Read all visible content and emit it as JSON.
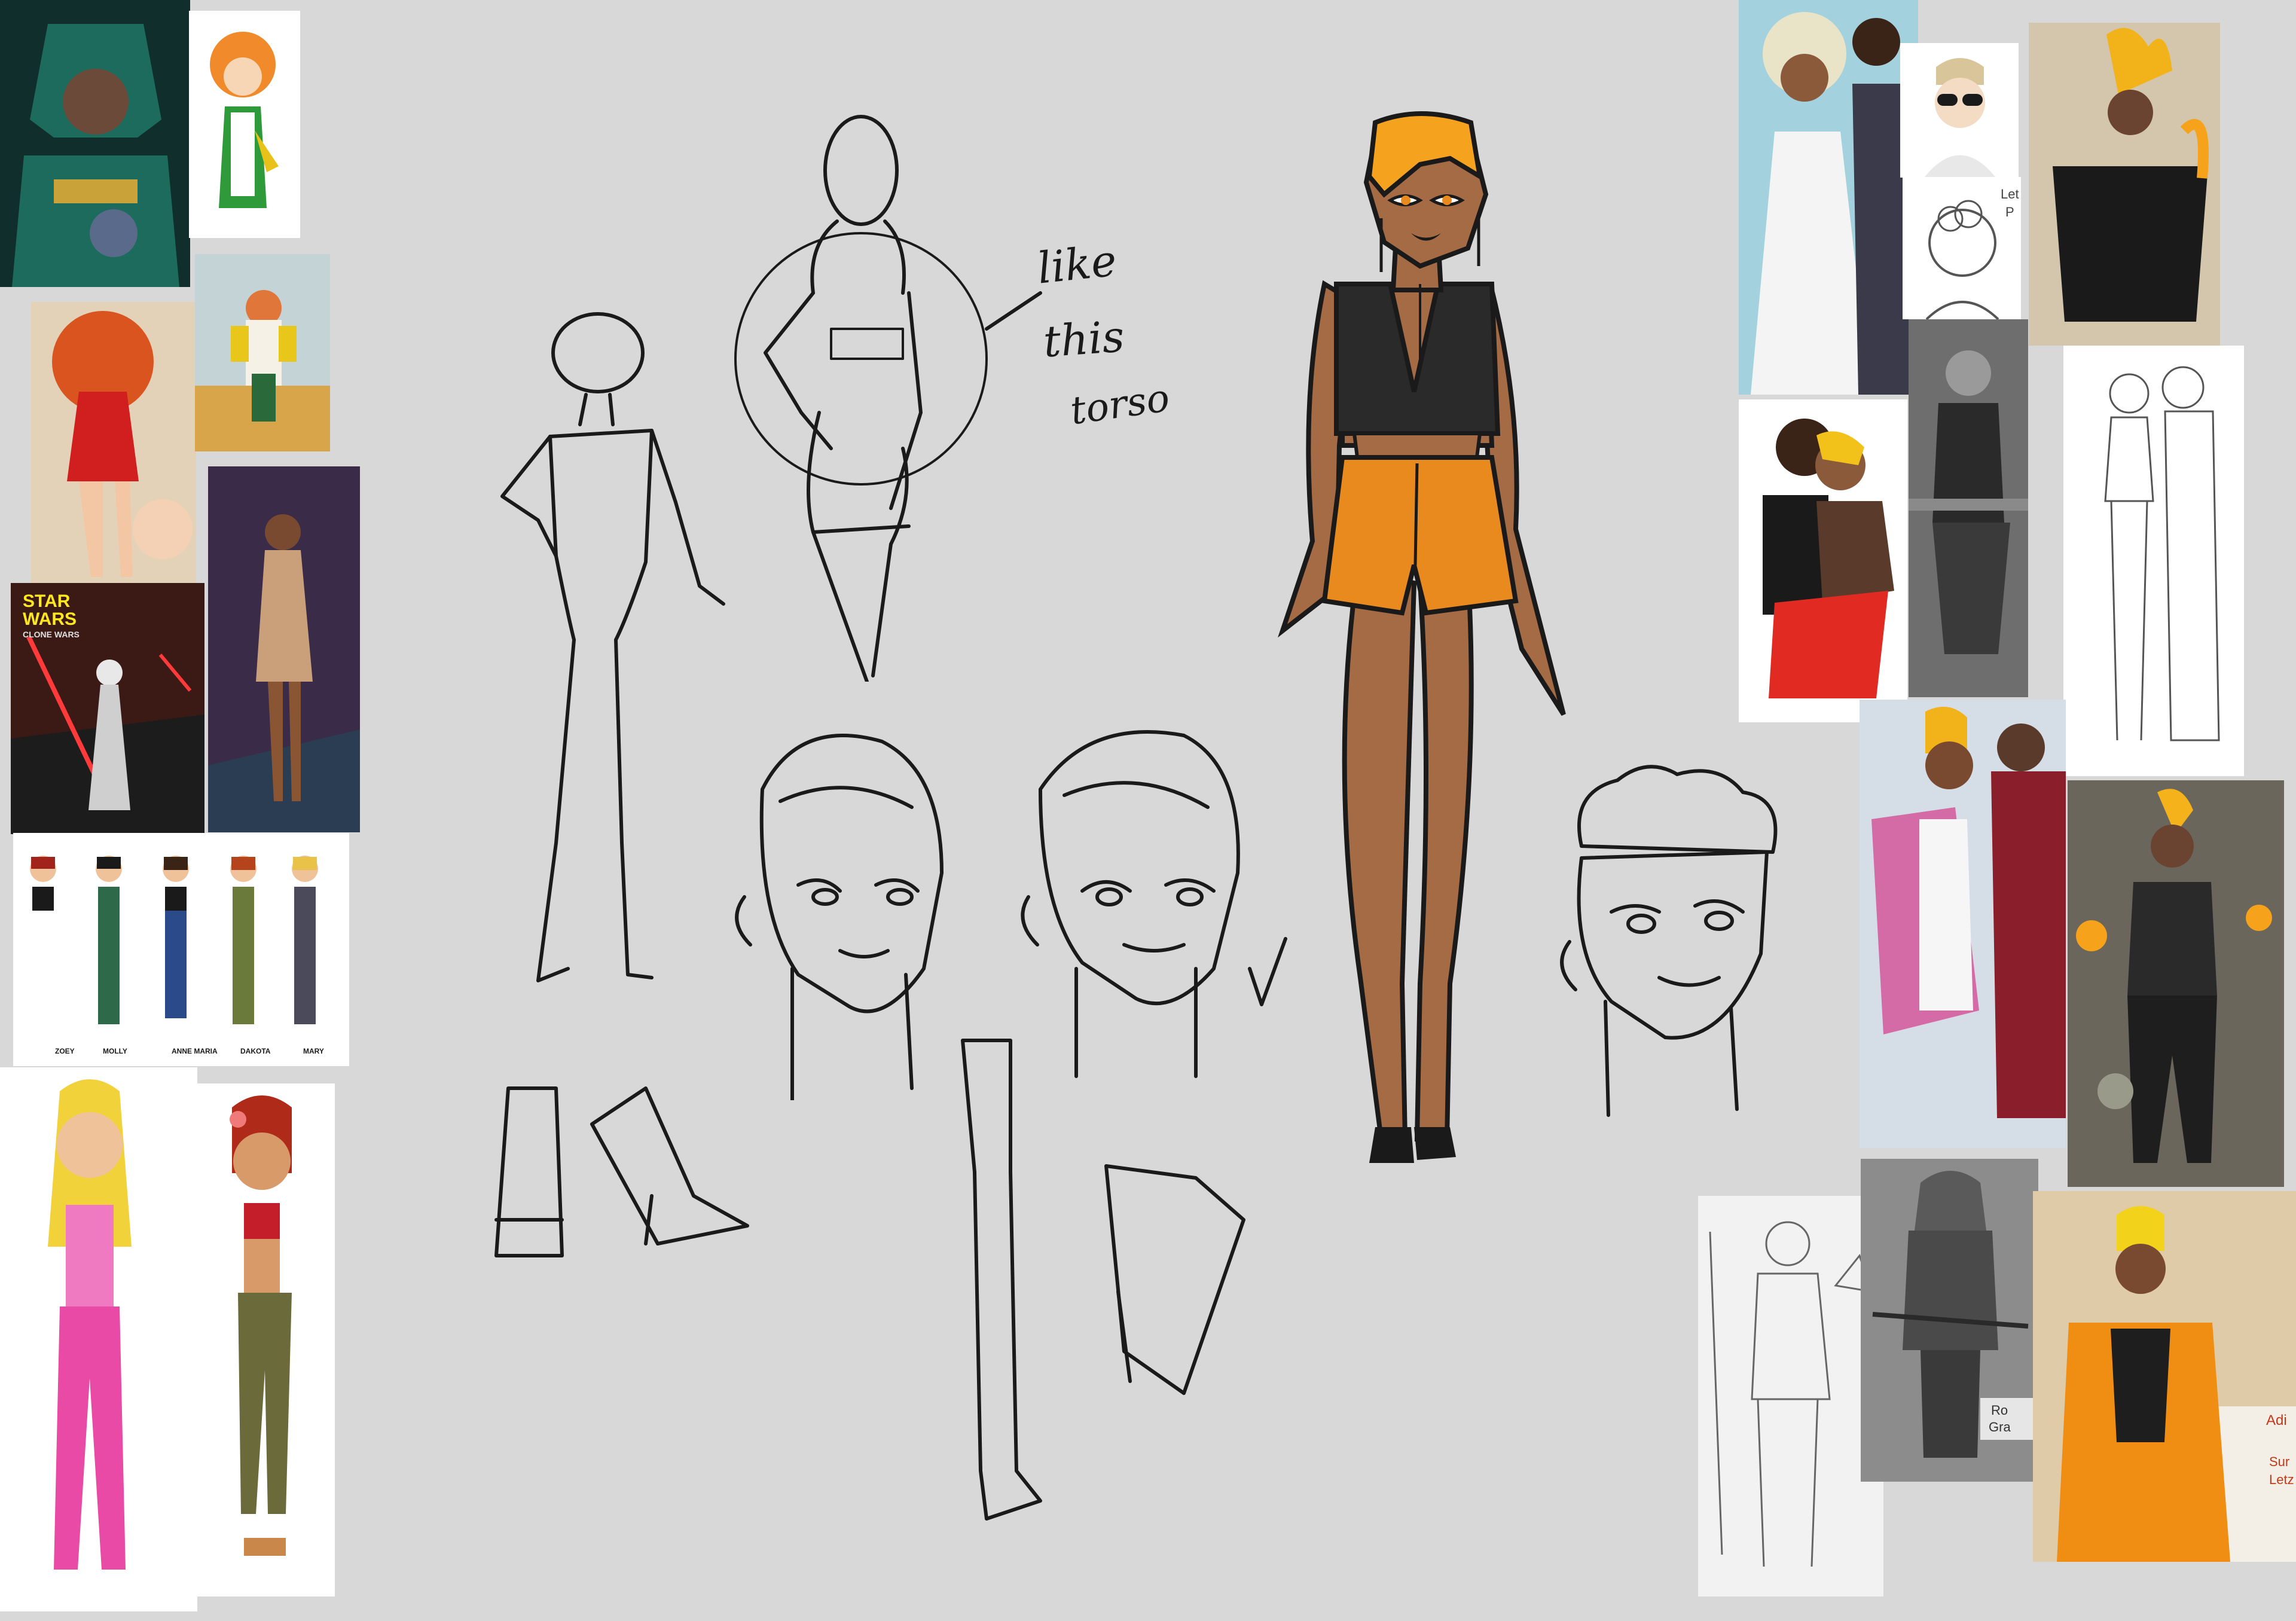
{
  "refs": {
    "starwars": {
      "line1": "STAR",
      "line2": "WARS",
      "line3": "CLONE WARS"
    },
    "lineup": [
      "ZOEY",
      "MOLLY",
      "ANNE MARIA",
      "DAKOTA",
      "MARY"
    ],
    "handwritten_note": {
      "line1": "like",
      "line2": "this",
      "line3": "torso"
    },
    "speech_bubble": {
      "line1": "Let",
      "line2": "P"
    },
    "sign": {
      "line1": "Ro",
      "line2": "Gra"
    },
    "shop_text": {
      "line1": "Adi",
      "line2": "Sur",
      "line3": "Letz"
    }
  },
  "colors": {
    "canvas_bg": "#d8d8d8",
    "skin": "#a56b45",
    "hair_orange": "#f5a21e",
    "shorts_orange": "#e98a1f",
    "top_black": "#2a2a2a",
    "ink": "#1a1a1a"
  }
}
